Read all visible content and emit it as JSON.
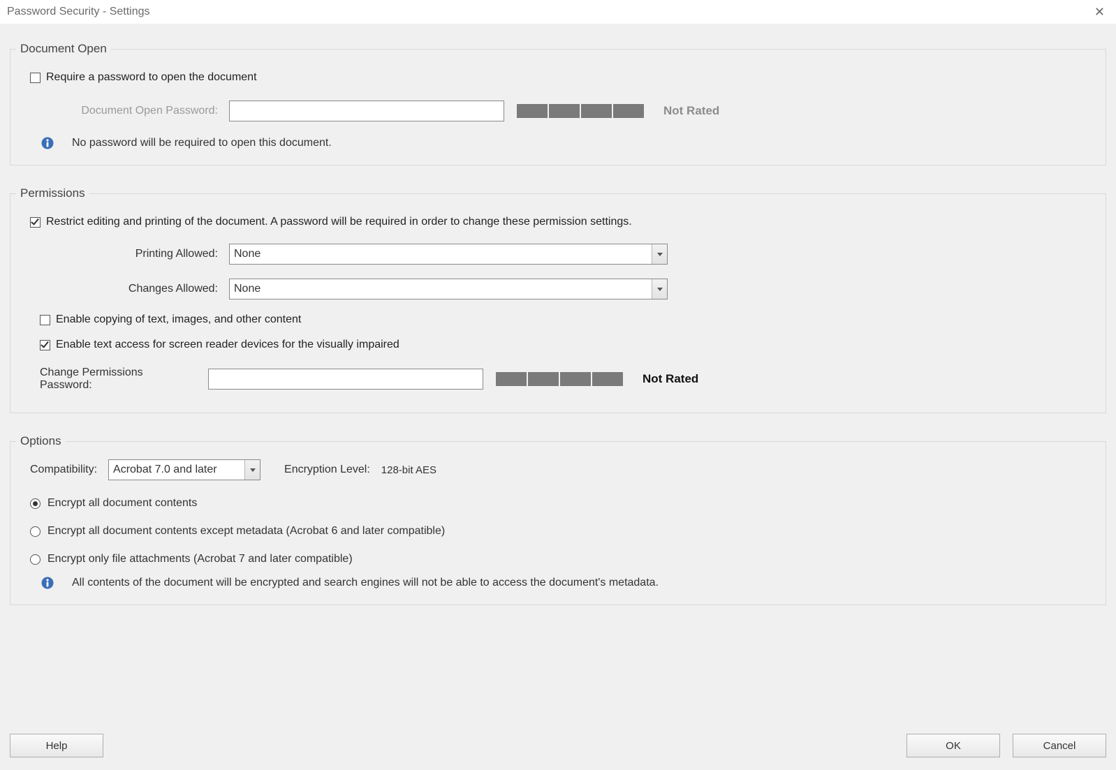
{
  "window": {
    "title": "Password Security - Settings"
  },
  "docOpen": {
    "legend": "Document Open",
    "requireCheckboxLabel": "Require a password to open the document",
    "requireChecked": false,
    "passwordLabel": "Document Open Password:",
    "passwordValue": "",
    "strengthRating": "Not Rated",
    "infoText": "No password will be required to open this document."
  },
  "permissions": {
    "legend": "Permissions",
    "restrictLabel": "Restrict editing and printing of the document. A password will be required in order to change these permission settings.",
    "restrictChecked": true,
    "printingLabel": "Printing Allowed:",
    "printingValue": "None",
    "changesLabel": "Changes Allowed:",
    "changesValue": "None",
    "enableCopyLabel": "Enable copying of text, images, and other content",
    "enableCopyChecked": false,
    "enableAccessLabel": "Enable text access for screen reader devices for the visually impaired",
    "enableAccessChecked": true,
    "changePwLabel": "Change Permissions Password:",
    "changePwValue": "",
    "strengthRating": "Not Rated"
  },
  "options": {
    "legend": "Options",
    "compatLabel": "Compatibility:",
    "compatValue": "Acrobat 7.0 and later",
    "encLevelLabel": "Encryption  Level:",
    "encLevelValue": "128-bit AES",
    "radio1": "Encrypt all document contents",
    "radio2": "Encrypt all document contents except metadata (Acrobat 6 and later compatible)",
    "radio3": "Encrypt only file attachments (Acrobat 7 and later compatible)",
    "radioSelected": 0,
    "infoText": "All contents of the document will be encrypted and search engines will not be able to access the document's metadata."
  },
  "buttons": {
    "help": "Help",
    "ok": "OK",
    "cancel": "Cancel"
  }
}
